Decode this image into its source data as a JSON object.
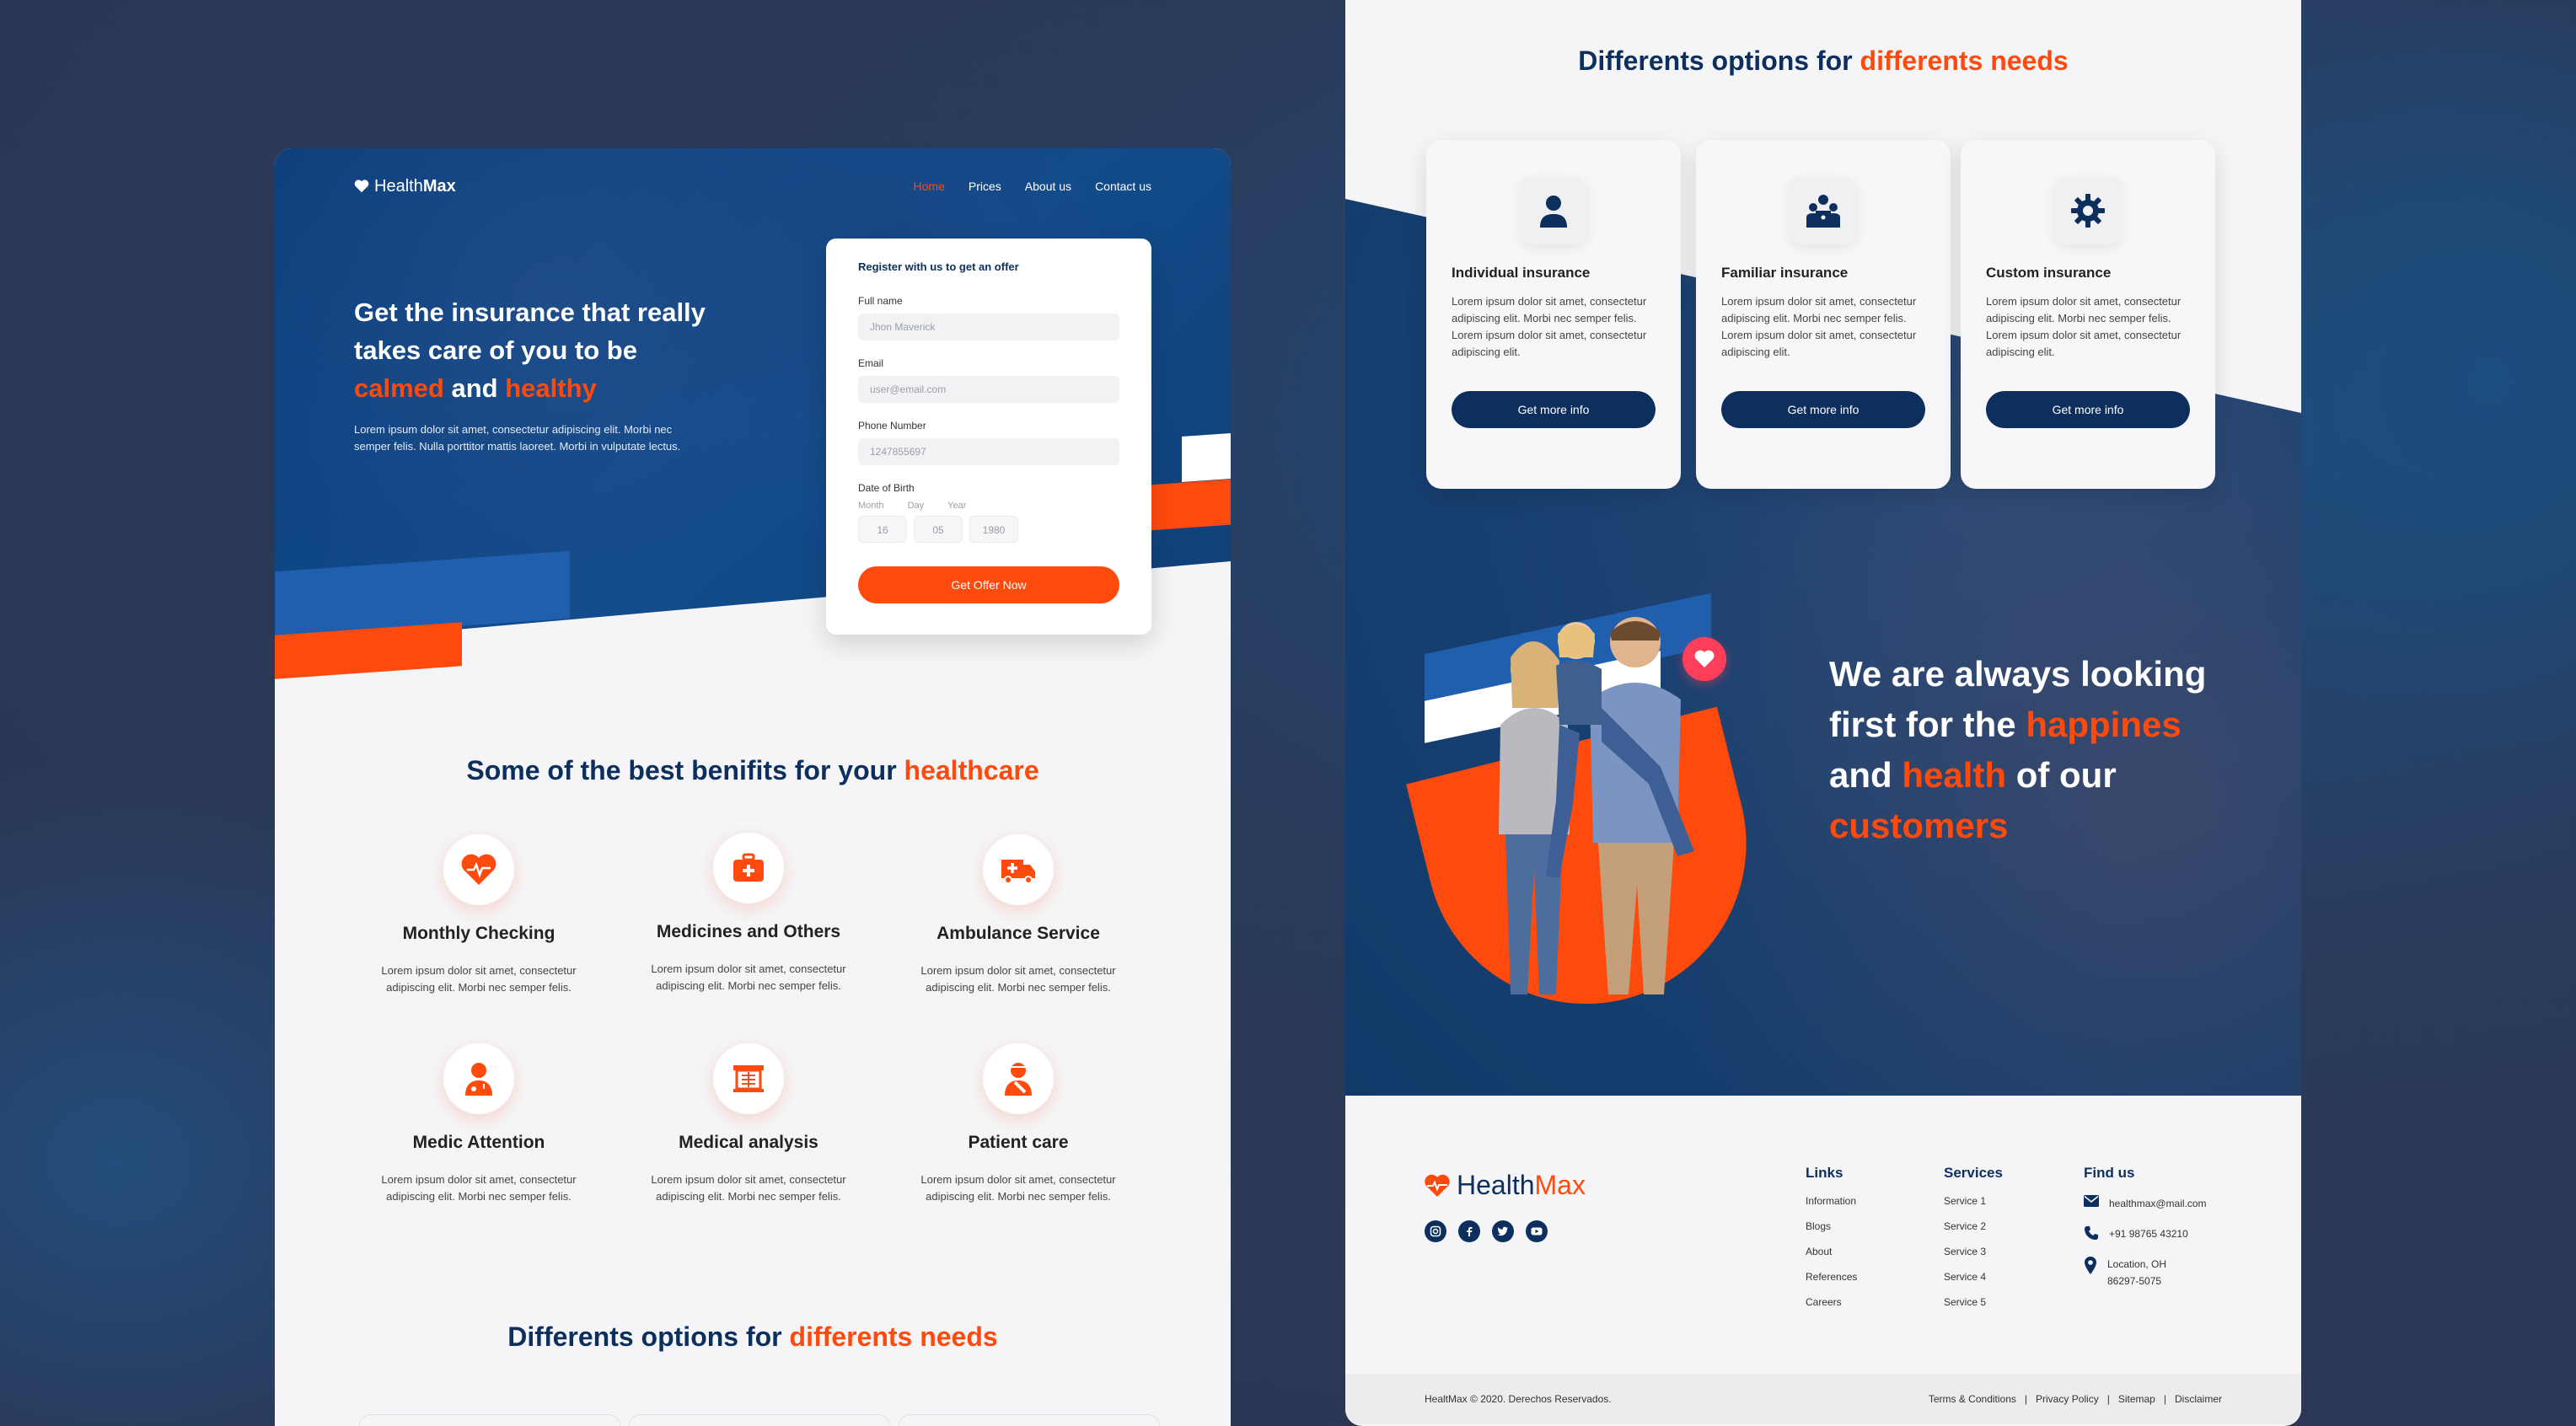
{
  "left": {
    "nav": {
      "logo_pre": "Health",
      "logo_bold": "Max",
      "links": [
        "Home",
        "Prices",
        "About us",
        "Contact us"
      ]
    },
    "hero": {
      "title_line1": "Get the insurance that really",
      "title_line2": "takes care of you to be",
      "title_calmed": "calmed",
      "title_and": "and",
      "title_healthy": "healthy",
      "description": "Lorem ipsum dolor sit amet, consectetur adipiscing elit. Morbi nec semper felis. Nulla porttitor mattis laoreet. Morbi in vulputate lectus."
    },
    "form": {
      "title": "Register with us to get an offer",
      "fullname_label": "Full name",
      "fullname_placeholder": "Jhon Maverick",
      "email_label": "Email",
      "email_placeholder": "user@email.com",
      "phone_label": "Phone Number",
      "phone_placeholder": "1247855697",
      "dob_label": "Date of Birth",
      "dob_month_label": "Month",
      "dob_day_label": "Day",
      "dob_year_label": "Year",
      "dob_month": "16",
      "dob_day": "05",
      "dob_year": "1980",
      "submit": "Get Offer Now"
    },
    "benefits_title_pre": "Some of the best benifits for your",
    "benefits_title_accent": "healthcare",
    "benefits": [
      {
        "title": "Monthly Checking",
        "desc": "Lorem ipsum dolor sit amet, consectetur adipiscing elit. Morbi nec semper felis.",
        "icon": "heart-pulse-icon"
      },
      {
        "title": "Medicines and Others",
        "desc": "Lorem ipsum dolor sit amet, consectetur adipiscing elit. Morbi nec semper felis.",
        "icon": "first-aid-kit-icon"
      },
      {
        "title": "Ambulance Service",
        "desc": "Lorem ipsum dolor sit amet, consectetur adipiscing elit. Morbi nec semper felis.",
        "icon": "ambulance-icon"
      },
      {
        "title": "Medic Attention",
        "desc": "Lorem ipsum dolor sit amet, consectetur adipiscing elit. Morbi nec semper felis.",
        "icon": "doctor-icon"
      },
      {
        "title": "Medical analysis",
        "desc": "Lorem ipsum dolor sit amet, consectetur adipiscing elit. Morbi nec semper felis.",
        "icon": "xray-icon"
      },
      {
        "title": "Patient care",
        "desc": "Lorem ipsum dolor sit amet, consectetur adipiscing elit. Morbi nec semper felis.",
        "icon": "patient-icon"
      }
    ],
    "options_title_pre": "Differents options for",
    "options_title_accent": "differents needs"
  },
  "right": {
    "options_title_pre": "Differents options for",
    "options_title_accent": "differents needs",
    "cards": [
      {
        "title": "Individual insurance",
        "desc": "Lorem ipsum dolor sit amet, consectetur adipiscing elit. Morbi nec semper felis.  Lorem ipsum dolor sit amet, consectetur adipiscing elit.",
        "button": "Get  more info",
        "icon": "person-icon"
      },
      {
        "title": "Familiar insurance",
        "desc": "Lorem ipsum dolor sit amet, consectetur adipiscing elit. Morbi nec semper felis.  Lorem ipsum dolor sit amet, consectetur adipiscing elit.",
        "button": "Get  more info",
        "icon": "family-icon"
      },
      {
        "title": "Custom insurance",
        "desc": "Lorem ipsum dolor sit amet, consectetur adipiscing elit. Morbi nec semper felis.  Lorem ipsum dolor sit amet, consectetur adipiscing elit.",
        "button": "Get  more info",
        "icon": "gear-icon"
      }
    ],
    "happy": {
      "line1": "We are always looking",
      "line2_pre": "first for the",
      "line2_accent": "happines",
      "line3_pre": "and",
      "line3_accent": "health",
      "line3_post": "of our",
      "line4_accent": "customers"
    },
    "footer": {
      "logo_pre": "Health",
      "logo_accent": "Max",
      "links_title": "Links",
      "links": [
        "Information",
        "Blogs",
        "About",
        "References",
        "Careers"
      ],
      "services_title": "Services",
      "services": [
        "Service 1",
        "Service 2",
        "Service 3",
        "Service 4",
        "Service 5"
      ],
      "find_title": "Find us",
      "email": "healthmax@mail.com",
      "phone": "+91 98765 43210",
      "location_line1": "Location, OH",
      "location_line2": "86297-5075",
      "copyright": "HealtMax © 2020. Derechos Reservados.",
      "legal": [
        "Terms & Conditions",
        "Privacy Policy",
        "Sitemap",
        "Disclaimer"
      ],
      "separator": "|"
    }
  },
  "colors": {
    "navy": "#0c2f5e",
    "orange": "#ff4a0e",
    "blue": "#124c8c",
    "light_bg": "#f5f5f7"
  }
}
